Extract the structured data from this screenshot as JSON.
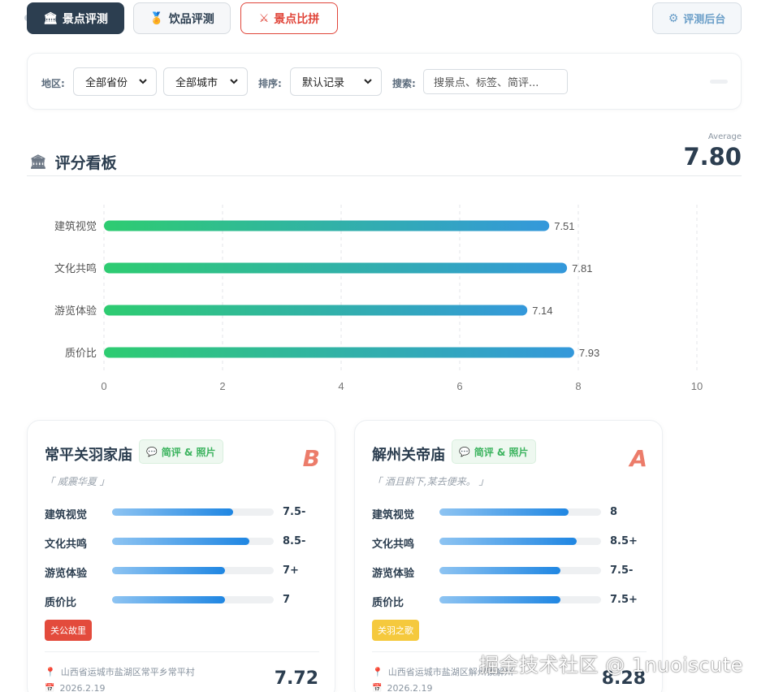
{
  "tabs": {
    "scenic": {
      "icon": "🏛",
      "label": "景点评测"
    },
    "drink": {
      "icon": "🏅",
      "label": "饮品评测"
    },
    "compare": {
      "icon": "⚔",
      "label": "景点比拼"
    },
    "admin": {
      "icon": "⚙",
      "label": "评测后台"
    }
  },
  "filter": {
    "region_label": "地区:",
    "province": "全部省份",
    "city": "全部城市",
    "sort_label": "排序:",
    "sort": "默认记录",
    "search_label": "搜索:",
    "search_placeholder": "搜景点、标签、简评..."
  },
  "dashboard": {
    "icon": "🏛",
    "title": "评分看板",
    "average_label": "Average",
    "average_value": "7.80"
  },
  "chart_data": {
    "type": "bar",
    "orientation": "horizontal",
    "categories": [
      "建筑视觉",
      "文化共鸣",
      "游览体验",
      "质价比"
    ],
    "values": [
      7.51,
      7.81,
      7.14,
      7.93
    ],
    "value_labels": [
      "7.51",
      "7.81",
      "7.14",
      "7.93"
    ],
    "xlim": [
      0,
      10
    ],
    "xticks": [
      "0",
      "2",
      "4",
      "6",
      "8",
      "10"
    ],
    "grid": true,
    "colors": {
      "bar_start": "#2ecc71",
      "bar_end": "#3498db"
    }
  },
  "cards": [
    {
      "title": "常平关羽家庙",
      "tag_icon": "💬",
      "tag": "简评 & 照片",
      "grade": "B",
      "quote": "「 威震华夏 」",
      "rows": [
        {
          "label": "建筑视觉",
          "score": 7.5,
          "display": "7.5-"
        },
        {
          "label": "文化共鸣",
          "score": 8.5,
          "display": "8.5-"
        },
        {
          "label": "游览体验",
          "score": 7,
          "display": "7+"
        },
        {
          "label": "质价比",
          "score": 7,
          "display": "7"
        }
      ],
      "badge": "关公故里",
      "badge_color": "#e34b3c",
      "address": "山西省运城市盐湖区常平乡常平村",
      "date": "2026.2.19",
      "total": "7.72"
    },
    {
      "title": "解州关帝庙",
      "tag_icon": "💬",
      "tag": "简评 & 照片",
      "grade": "A",
      "quote": "「 酒且斟下,某去便来。 」",
      "rows": [
        {
          "label": "建筑视觉",
          "score": 8,
          "display": "8"
        },
        {
          "label": "文化共鸣",
          "score": 8.5,
          "display": "8.5+"
        },
        {
          "label": "游览体验",
          "score": 7.5,
          "display": "7.5-"
        },
        {
          "label": "质价比",
          "score": 7.5,
          "display": "7.5+"
        }
      ],
      "badge": "关羽之歌",
      "badge_color": "#f5c93d",
      "address": "山西省运城市盐湖区解州镇解州",
      "date": "2026.2.19",
      "total": "8.28"
    }
  ],
  "watermark": "掘金技术社区 @ 1nuoiscute"
}
